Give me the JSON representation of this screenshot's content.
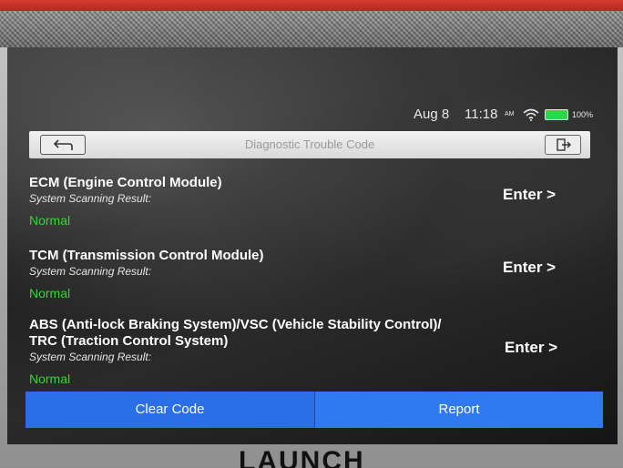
{
  "status_bar": {
    "date": "Aug 8",
    "time": "11:18",
    "ampm": "AM",
    "battery": "100%"
  },
  "header": {
    "title": "Diagnostic Trouble Code",
    "back_icon": "back-arrow-icon",
    "exit_icon": "exit-icon"
  },
  "modules": [
    {
      "title_line1": "ECM (Engine Control Module)",
      "title_line2": "",
      "subtitle": "System Scanning Result:",
      "status": "Normal",
      "enter_label": "Enter >"
    },
    {
      "title_line1": "TCM (Transmission Control Module)",
      "title_line2": "",
      "subtitle": "System Scanning Result:",
      "status": "Normal",
      "enter_label": "Enter >"
    },
    {
      "title_line1": "ABS (Anti-lock Braking System)/VSC (Vehicle Stability Control)/",
      "title_line2": "TRC (Traction Control System)",
      "subtitle": "System Scanning Result:",
      "status": "Normal",
      "enter_label": "Enter >"
    }
  ],
  "actions": {
    "clear_label": "Clear Code",
    "report_label": "Report"
  },
  "brand": "LAUNCH",
  "colors": {
    "accent_blue": "#2f7af0",
    "status_green": "#3bd13b",
    "battery_green": "#2fd64a",
    "device_red": "#d63a2f"
  }
}
